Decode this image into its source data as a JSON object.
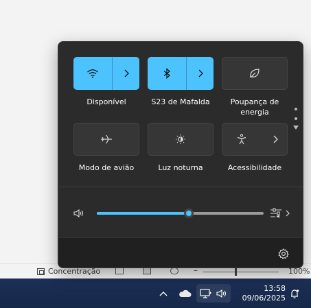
{
  "statusbar": {
    "focus_label": "Concentração",
    "zoom_percent": 100,
    "zoom_percent_text": "100%"
  },
  "quick_settings": {
    "tiles": [
      {
        "id": "wifi",
        "label": "Disponível",
        "state": "on",
        "icon": "wifi-icon"
      },
      {
        "id": "bluetooth",
        "label": "S23 de Mafalda",
        "state": "on",
        "icon": "bluetooth-icon"
      },
      {
        "id": "energy_saver",
        "label_line1": "Poupança de",
        "label_line2": "energia",
        "state": "off",
        "icon": "leaf-icon"
      },
      {
        "id": "airplane",
        "label": "Modo de avião",
        "state": "off",
        "icon": "airplane-icon"
      },
      {
        "id": "night_light",
        "label": "Luz noturna",
        "state": "off",
        "icon": "brightness-icon"
      },
      {
        "id": "accessibility",
        "label": "Acessibilidade",
        "state": "off",
        "icon": "accessibility-icon"
      }
    ],
    "volume": {
      "level": 0.55,
      "icon": "speaker-icon"
    },
    "accent_color": "#4cc2ff"
  },
  "taskbar": {
    "time": "13:58",
    "date": "09/06/2025",
    "background": "#1a2c4f"
  }
}
